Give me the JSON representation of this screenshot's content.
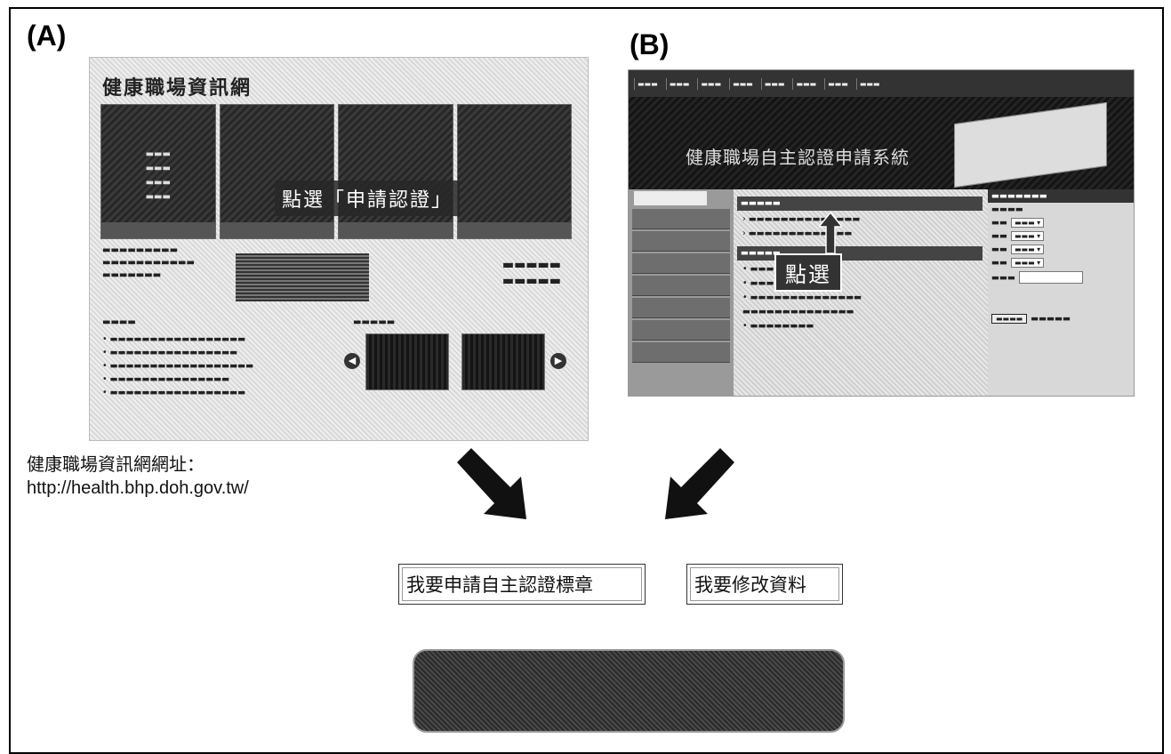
{
  "labels": {
    "a": "(A)",
    "b": "(B)"
  },
  "screenshot_a": {
    "site_title": "健康職場資訊網",
    "callout": "點選「申請認證」"
  },
  "screenshot_b": {
    "system_title": "健康職場自主認證申請系統",
    "callout": "點選"
  },
  "url_block": {
    "label": "健康職場資訊網網址：",
    "url": "http://health.bhp.doh.gov.tw/"
  },
  "buttons": {
    "apply": "我要申請自主認證標章",
    "modify": "我要修改資料"
  }
}
